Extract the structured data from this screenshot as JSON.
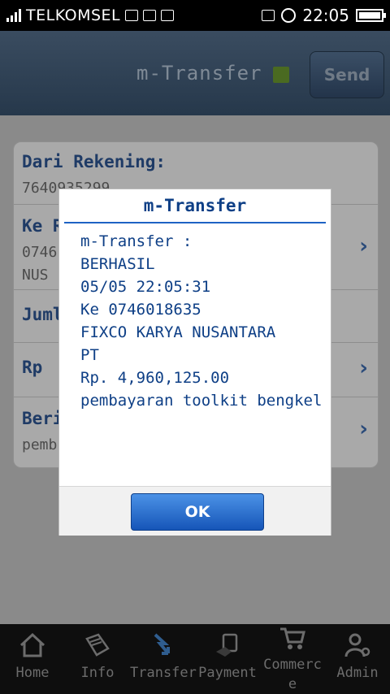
{
  "status": {
    "carrier": "TELKOMSEL",
    "time": "22:05"
  },
  "header": {
    "title": "m-Transfer",
    "send_label": "Send"
  },
  "form": {
    "rows": [
      {
        "label": "Dari Rekening:",
        "value": "7640935299"
      },
      {
        "label": "Ke R",
        "value": "0746",
        "value2": "NUS"
      },
      {
        "label": "Juml",
        "value": ""
      },
      {
        "label": "Rp",
        "value": ""
      },
      {
        "label": "Berit",
        "value": "pemb"
      }
    ]
  },
  "dialog": {
    "title": "m-Transfer",
    "lines": [
      "m-Transfer :",
      "BERHASIL",
      "05/05 22:05:31",
      "Ke 0746018635",
      "FIXCO KARYA NUSANTARA",
      "PT",
      "Rp. 4,960,125.00",
      "pembayaran toolkit bengkel"
    ],
    "ok_label": "OK"
  },
  "tabs": [
    {
      "label": "Home",
      "icon": "home-icon"
    },
    {
      "label": "Info",
      "icon": "info-book-icon"
    },
    {
      "label": "Transfer",
      "icon": "transfer-icon"
    },
    {
      "label": "Payment",
      "icon": "payment-icon"
    },
    {
      "label": "Commerce",
      "icon": "cart-icon"
    },
    {
      "label": "Admin",
      "icon": "admin-icon"
    }
  ]
}
